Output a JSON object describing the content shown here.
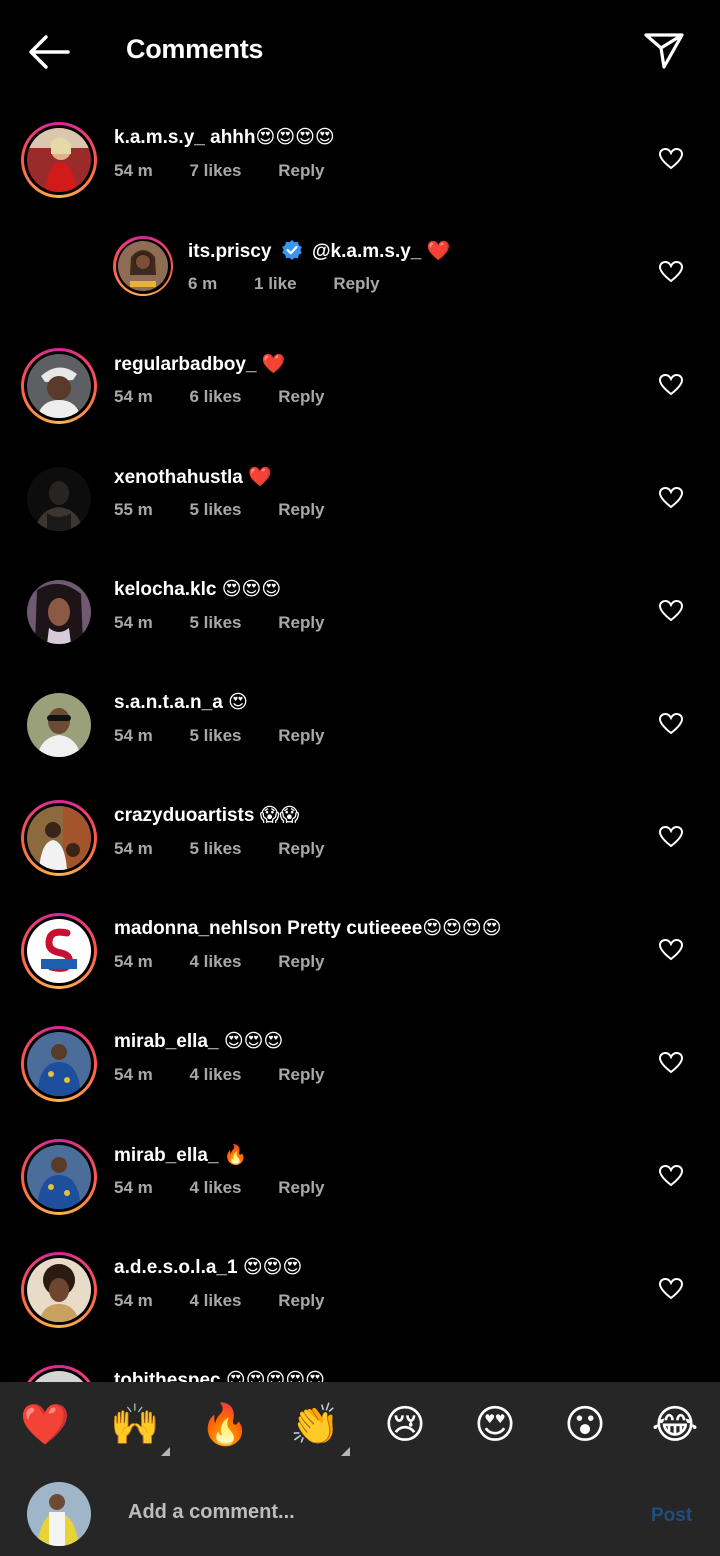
{
  "header": {
    "title": "Comments",
    "back_icon": "arrow-left-icon",
    "send_icon": "paper-plane-icon"
  },
  "comments": [
    {
      "user": "k.a.m.s.y_",
      "text": "ahhh😍😍😍😍",
      "time": "54 m",
      "likes": "7 likes",
      "reply": "Reply"
    },
    {
      "user": "its.priscy",
      "verified": true,
      "text": "@k.a.m.s.y_ ❤️",
      "time": "6 m",
      "likes": "1 like",
      "reply": "Reply"
    },
    {
      "user": "regularbadboy_",
      "text": "❤️",
      "time": "54 m",
      "likes": "6 likes",
      "reply": "Reply"
    },
    {
      "user": "xenothahustla",
      "text": "❤️",
      "time": "55 m",
      "likes": "5 likes",
      "reply": "Reply"
    },
    {
      "user": "kelocha.klc",
      "text": "😍😍😍",
      "time": "54 m",
      "likes": "5 likes",
      "reply": "Reply"
    },
    {
      "user": "s.a.n.t.a.n_a",
      "text": "😍",
      "time": "54 m",
      "likes": "5 likes",
      "reply": "Reply"
    },
    {
      "user": "crazyduoartists",
      "text": "😱😱",
      "time": "54 m",
      "likes": "5 likes",
      "reply": "Reply"
    },
    {
      "user": "madonna_nehlson",
      "text": "Pretty cutieeee😍😍😍😍",
      "time": "54 m",
      "likes": "4 likes",
      "reply": "Reply"
    },
    {
      "user": "mirab_ella_",
      "text": "😍😍😍",
      "time": "54 m",
      "likes": "4 likes",
      "reply": "Reply"
    },
    {
      "user": "mirab_ella_",
      "text": "🔥",
      "time": "54 m",
      "likes": "4 likes",
      "reply": "Reply"
    },
    {
      "user": "a.d.e.s.o.l.a_1",
      "text": "😍😍😍",
      "time": "54 m",
      "likes": "4 likes",
      "reply": "Reply"
    },
    {
      "user": "tobithespec",
      "text": "😍😍😍😍😍"
    }
  ],
  "emoji_bar": [
    "❤️",
    "🙌",
    "🔥",
    "👏",
    "😢",
    "😍",
    "😮",
    "😂"
  ],
  "composer": {
    "placeholder": "Add a comment...",
    "post_label": "Post"
  },
  "colors": {
    "background": "#000000",
    "meta_text": "#a8a8a8",
    "bar_background": "#262626",
    "post_disabled": "#1d4f7f",
    "verified_blue": "#3897f0"
  }
}
